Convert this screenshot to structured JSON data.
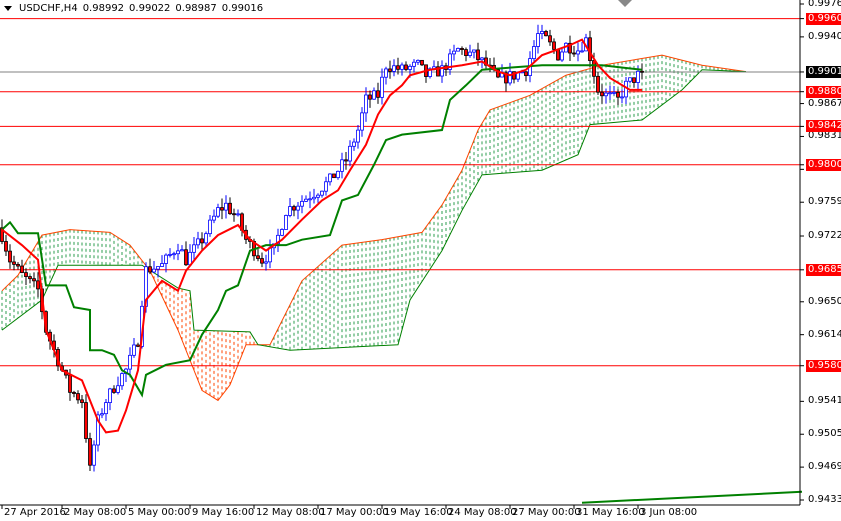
{
  "header": {
    "symbol": "USDCHF,H4",
    "open": "0.98992",
    "high": "0.99022",
    "low": "0.98987",
    "close": "0.99016"
  },
  "colors": {
    "bull": "#0000ff",
    "bear_body": "#ff0000",
    "tenkan": "#ff0000",
    "kijun": "#008000",
    "cloud_up": "#2e9e4f",
    "cloud_down": "#ff4500",
    "level": "#ff0000"
  },
  "price_axis": [
    "0.99760",
    "0.99400",
    "0.98670",
    "0.98310",
    "0.97950",
    "0.97590",
    "0.97220",
    "0.96500",
    "0.96140",
    "0.95410",
    "0.95050",
    "0.94690",
    "0.94330"
  ],
  "levels": [
    "0.99600",
    "0.98800",
    "0.98420",
    "0.98000",
    "0.96850",
    "0.95800"
  ],
  "current_price": "0.99016",
  "time_axis": [
    {
      "bar": 0,
      "label": "27 Apr 2016"
    },
    {
      "bar": 15,
      "label": "2 May 08:00"
    },
    {
      "bar": 31,
      "label": "5 May 00:00"
    },
    {
      "bar": 47,
      "label": "9 May 16:00"
    },
    {
      "bar": 63,
      "label": "12 May 08:00"
    },
    {
      "bar": 79,
      "label": "17 May 00:00"
    },
    {
      "bar": 95,
      "label": "19 May 16:00"
    },
    {
      "bar": 111,
      "label": "24 May 08:00"
    },
    {
      "bar": 127,
      "label": "27 May 00:00"
    },
    {
      "bar": 143,
      "label": "31 May 16:00"
    },
    {
      "bar": 159,
      "label": "3 Jun 08:00"
    }
  ],
  "chart_data": {
    "type": "candlestick-ichimoku",
    "ylim": [
      0.9433,
      0.9976
    ],
    "xlim_bars": [
      0,
      200
    ],
    "close_path": [
      [
        0,
        0.9723
      ],
      [
        2,
        0.9696
      ],
      [
        5,
        0.9679
      ],
      [
        9,
        0.9663
      ],
      [
        11,
        0.9619
      ],
      [
        14,
        0.9586
      ],
      [
        17,
        0.9553
      ],
      [
        20,
        0.9542
      ],
      [
        22,
        0.9466
      ],
      [
        24,
        0.952
      ],
      [
        26,
        0.9542
      ],
      [
        29,
        0.9564
      ],
      [
        31,
        0.9575
      ],
      [
        34,
        0.9608
      ],
      [
        35,
        0.9652
      ],
      [
        36,
        0.9685
      ],
      [
        40,
        0.969
      ],
      [
        44,
        0.9712
      ],
      [
        46,
        0.9696
      ],
      [
        50,
        0.9718
      ],
      [
        54,
        0.975
      ],
      [
        56,
        0.9756
      ],
      [
        59,
        0.974
      ],
      [
        61,
        0.9718
      ],
      [
        65,
        0.9696
      ],
      [
        68,
        0.9707
      ],
      [
        71,
        0.975
      ],
      [
        75,
        0.9761
      ],
      [
        79,
        0.9772
      ],
      [
        82,
        0.9783
      ],
      [
        86,
        0.9805
      ],
      [
        89,
        0.9838
      ],
      [
        91,
        0.9871
      ],
      [
        94,
        0.9876
      ],
      [
        96,
        0.9909
      ],
      [
        100,
        0.9904
      ],
      [
        104,
        0.9909
      ],
      [
        106,
        0.9898
      ],
      [
        110,
        0.9904
      ],
      [
        114,
        0.9926
      ],
      [
        118,
        0.992
      ],
      [
        121,
        0.9909
      ],
      [
        124,
        0.9893
      ],
      [
        128,
        0.9898
      ],
      [
        131,
        0.9904
      ],
      [
        134,
        0.9942
      ],
      [
        136,
        0.9937
      ],
      [
        139,
        0.992
      ],
      [
        141,
        0.9931
      ],
      [
        144,
        0.9926
      ],
      [
        146,
        0.9937
      ],
      [
        149,
        0.9882
      ],
      [
        151,
        0.9876
      ],
      [
        154,
        0.9871
      ],
      [
        156,
        0.9887
      ],
      [
        160,
        0.99016
      ]
    ],
    "tenkan": [
      [
        0,
        0.9729
      ],
      [
        5,
        0.9712
      ],
      [
        9,
        0.9696
      ],
      [
        11,
        0.9619
      ],
      [
        15,
        0.9575
      ],
      [
        20,
        0.9564
      ],
      [
        24,
        0.952
      ],
      [
        26,
        0.9507
      ],
      [
        29,
        0.9509
      ],
      [
        31,
        0.9531
      ],
      [
        34,
        0.9575
      ],
      [
        36,
        0.9652
      ],
      [
        40,
        0.9673
      ],
      [
        44,
        0.9662
      ],
      [
        46,
        0.9684
      ],
      [
        50,
        0.9706
      ],
      [
        54,
        0.9723
      ],
      [
        59,
        0.9734
      ],
      [
        62,
        0.9718
      ],
      [
        66,
        0.9706
      ],
      [
        70,
        0.9718
      ],
      [
        75,
        0.974
      ],
      [
        80,
        0.9761
      ],
      [
        84,
        0.9772
      ],
      [
        87,
        0.9794
      ],
      [
        91,
        0.9822
      ],
      [
        94,
        0.9855
      ],
      [
        97,
        0.9876
      ],
      [
        100,
        0.9887
      ],
      [
        102,
        0.9898
      ],
      [
        107,
        0.9904
      ],
      [
        115,
        0.9909
      ],
      [
        120,
        0.9913
      ],
      [
        124,
        0.9902
      ],
      [
        127,
        0.9898
      ],
      [
        131,
        0.9904
      ],
      [
        135,
        0.992
      ],
      [
        142,
        0.9931
      ],
      [
        145,
        0.9937
      ],
      [
        149,
        0.9909
      ],
      [
        152,
        0.9895
      ],
      [
        157,
        0.9882
      ],
      [
        160,
        0.9882
      ]
    ],
    "kijun": [
      [
        0,
        0.9729
      ],
      [
        2,
        0.9737
      ],
      [
        4,
        0.9725
      ],
      [
        9,
        0.9725
      ],
      [
        11,
        0.9668
      ],
      [
        16,
        0.9668
      ],
      [
        18,
        0.9644
      ],
      [
        22,
        0.9641
      ],
      [
        22,
        0.9597
      ],
      [
        25,
        0.9597
      ],
      [
        28,
        0.9592
      ],
      [
        30,
        0.9575
      ],
      [
        32,
        0.957
      ],
      [
        35,
        0.9548
      ],
      [
        36,
        0.957
      ],
      [
        41,
        0.9581
      ],
      [
        47,
        0.9586
      ],
      [
        50,
        0.9614
      ],
      [
        54,
        0.9641
      ],
      [
        56,
        0.9662
      ],
      [
        59,
        0.9668
      ],
      [
        62,
        0.9706
      ],
      [
        66,
        0.9712
      ],
      [
        71,
        0.9712
      ],
      [
        75,
        0.9718
      ],
      [
        82,
        0.9723
      ],
      [
        85,
        0.9761
      ],
      [
        89,
        0.9767
      ],
      [
        93,
        0.98
      ],
      [
        96,
        0.9827
      ],
      [
        100,
        0.9833
      ],
      [
        110,
        0.9838
      ],
      [
        112,
        0.9871
      ],
      [
        116,
        0.9887
      ],
      [
        120,
        0.9904
      ],
      [
        135,
        0.9909
      ],
      [
        150,
        0.9909
      ],
      [
        160,
        0.9904
      ]
    ],
    "senkou_a": [
      [
        0,
        0.9662
      ],
      [
        4,
        0.9679
      ],
      [
        10,
        0.9723
      ],
      [
        17,
        0.9729
      ],
      [
        27,
        0.9726
      ],
      [
        32,
        0.9712
      ],
      [
        37,
        0.9684
      ],
      [
        44,
        0.9619
      ],
      [
        50,
        0.9553
      ],
      [
        54,
        0.9542
      ],
      [
        57,
        0.9559
      ],
      [
        61,
        0.9603
      ],
      [
        67,
        0.9603
      ],
      [
        75,
        0.9673
      ],
      [
        85,
        0.9712
      ],
      [
        95,
        0.9718
      ],
      [
        105,
        0.9726
      ],
      [
        110,
        0.9756
      ],
      [
        115,
        0.9794
      ],
      [
        119,
        0.9838
      ],
      [
        122,
        0.986
      ],
      [
        132,
        0.9876
      ],
      [
        141,
        0.9898
      ],
      [
        150,
        0.9909
      ],
      [
        165,
        0.992
      ],
      [
        175,
        0.9909
      ],
      [
        186,
        0.9902
      ]
    ],
    "senkou_b": [
      [
        0,
        0.9619
      ],
      [
        10,
        0.9652
      ],
      [
        14,
        0.969
      ],
      [
        35,
        0.969
      ],
      [
        44,
        0.9665
      ],
      [
        47,
        0.9662
      ],
      [
        48,
        0.9619
      ],
      [
        62,
        0.9617
      ],
      [
        64,
        0.9603
      ],
      [
        72,
        0.9597
      ],
      [
        99,
        0.9603
      ],
      [
        102,
        0.9652
      ],
      [
        110,
        0.9706
      ],
      [
        115,
        0.975
      ],
      [
        120,
        0.9789
      ],
      [
        135,
        0.9794
      ],
      [
        144,
        0.9811
      ],
      [
        147,
        0.9844
      ],
      [
        160,
        0.9849
      ],
      [
        170,
        0.9882
      ],
      [
        175,
        0.9904
      ],
      [
        186,
        0.9902
      ]
    ],
    "lower_line": [
      [
        145,
        0.943
      ],
      [
        200,
        0.9442
      ]
    ]
  }
}
